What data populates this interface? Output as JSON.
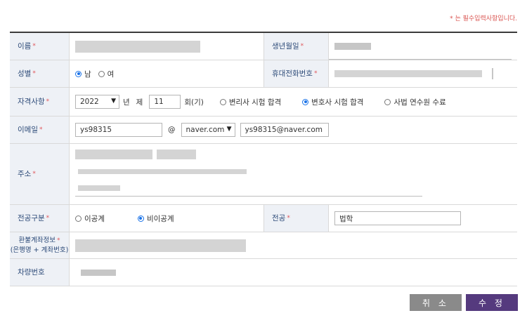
{
  "note": "* 는 필수입력사항입니다.",
  "required_mark": "*",
  "fields": {
    "name": {
      "label": "이름"
    },
    "birth": {
      "label": "생년월일"
    },
    "gender": {
      "label": "성별",
      "options": [
        "남",
        "여"
      ],
      "selected": "남"
    },
    "phone": {
      "label": "휴대전화번호"
    },
    "qualification": {
      "label": "자격사항",
      "year": "2022",
      "year_suffix": "년",
      "round_prefix": "제",
      "round": "11",
      "round_suffix": "회(기)",
      "options": [
        "변리사 시험 합격",
        "변호사 시험 합격",
        "사법 연수원 수료"
      ],
      "selected": "변호사 시험 합격"
    },
    "email": {
      "label": "이메일",
      "id": "ys98315",
      "at": "@",
      "domain_select": "naver.com",
      "full": "ys98315@naver.com"
    },
    "address": {
      "label": "주소"
    },
    "major_type": {
      "label": "전공구분",
      "options": [
        "이공계",
        "비이공계"
      ],
      "selected": "비이공계"
    },
    "major": {
      "label": "전공",
      "value": "법학"
    },
    "refund_account": {
      "label_line1": "환불계좌정보",
      "label_line2": "(은행명 + 계좌번호)"
    },
    "car_number": {
      "label": "차량번호"
    }
  },
  "buttons": {
    "cancel": "취 소",
    "submit": "수 정"
  },
  "colors": {
    "required": "#e0565b",
    "label_bg": "#eef1f6",
    "submit_bg": "#553a7e",
    "cancel_bg": "#8a8a8a"
  }
}
